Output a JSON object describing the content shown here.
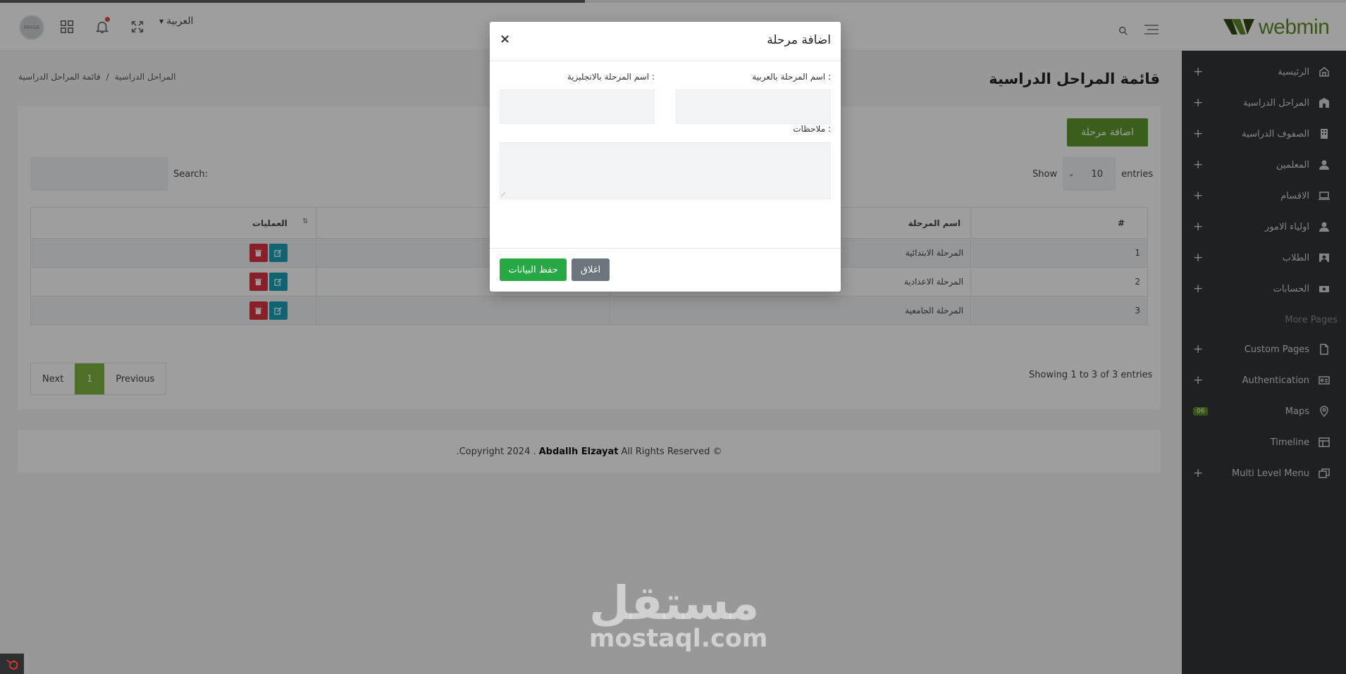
{
  "header": {
    "language": "العربية",
    "avatar_text": "IMAGE",
    "logo_text": "webmin"
  },
  "sidebar": {
    "items": [
      {
        "label": "الرئيسية",
        "icon": "home-icon"
      },
      {
        "label": "المراحل الدراسية",
        "icon": "school-icon"
      },
      {
        "label": "الصفوف الدراسية",
        "icon": "building-icon"
      },
      {
        "label": "المعلمين",
        "icon": "user-icon"
      },
      {
        "label": "الاقسام",
        "icon": "laptop-icon"
      },
      {
        "label": "اولياء الامور",
        "icon": "user-icon"
      },
      {
        "label": "الطلاب",
        "icon": "image-user-icon"
      },
      {
        "label": "الحسابات",
        "icon": "money-icon"
      }
    ],
    "section_title": "More Pages",
    "more_items": [
      {
        "label": "Custom Pages",
        "icon": "file-icon"
      },
      {
        "label": "Authentication",
        "icon": "id-card-icon"
      },
      {
        "label": "Maps",
        "icon": "map-pin-icon",
        "badge": "06"
      },
      {
        "label": "Timeline",
        "icon": "table-icon"
      },
      {
        "label": "Multi Level Menu",
        "icon": "layers-icon"
      }
    ]
  },
  "page": {
    "title": "قائمة المراحل الدراسية",
    "breadcrumb": [
      "المراحل الدراسية",
      "/",
      "قائمة المراحل الدراسية"
    ]
  },
  "list": {
    "add_label": "اضافة مرحلة",
    "show_label": "Show",
    "entries_count": "10",
    "entries_label": "entries",
    "search_label": "Search:",
    "columns": {
      "num": "#",
      "name": "اسم المرحلة",
      "ops": "العمليات"
    },
    "rows": [
      {
        "num": "1",
        "name": "المرحلة الابتدائية"
      },
      {
        "num": "2",
        "name": "المرحلة الاعدادية"
      },
      {
        "num": "3",
        "name": "المرحلة الجامعية"
      }
    ],
    "info": "Showing 1 to 3 of 3 entries",
    "pager": {
      "next": "Next",
      "current": "1",
      "previous": "Previous"
    }
  },
  "footer": {
    "prefix": ".Copyright 2024 .",
    "author": "Abdallh Elzayat",
    "suffix": "All Rights Reserved ©"
  },
  "modal": {
    "title": "اضافة مرحلة",
    "close_symbol": "×",
    "label_name_ar": "اسم المرحلة بالعربية :",
    "label_name_en": "اسم المرحلة بالانجليزية :",
    "label_notes": "ملاحظات :",
    "save_label": "حفظ البيانات",
    "close_label": "اغلاق"
  },
  "watermark": {
    "arabic": "مستقل",
    "latin": "mostaql.com"
  },
  "colors": {
    "brand": "#5d8c28",
    "sidebar_bg": "#323437",
    "save": "#28a745",
    "close": "#6c757d",
    "edit": "#17a2b8",
    "delete": "#dc3545"
  }
}
